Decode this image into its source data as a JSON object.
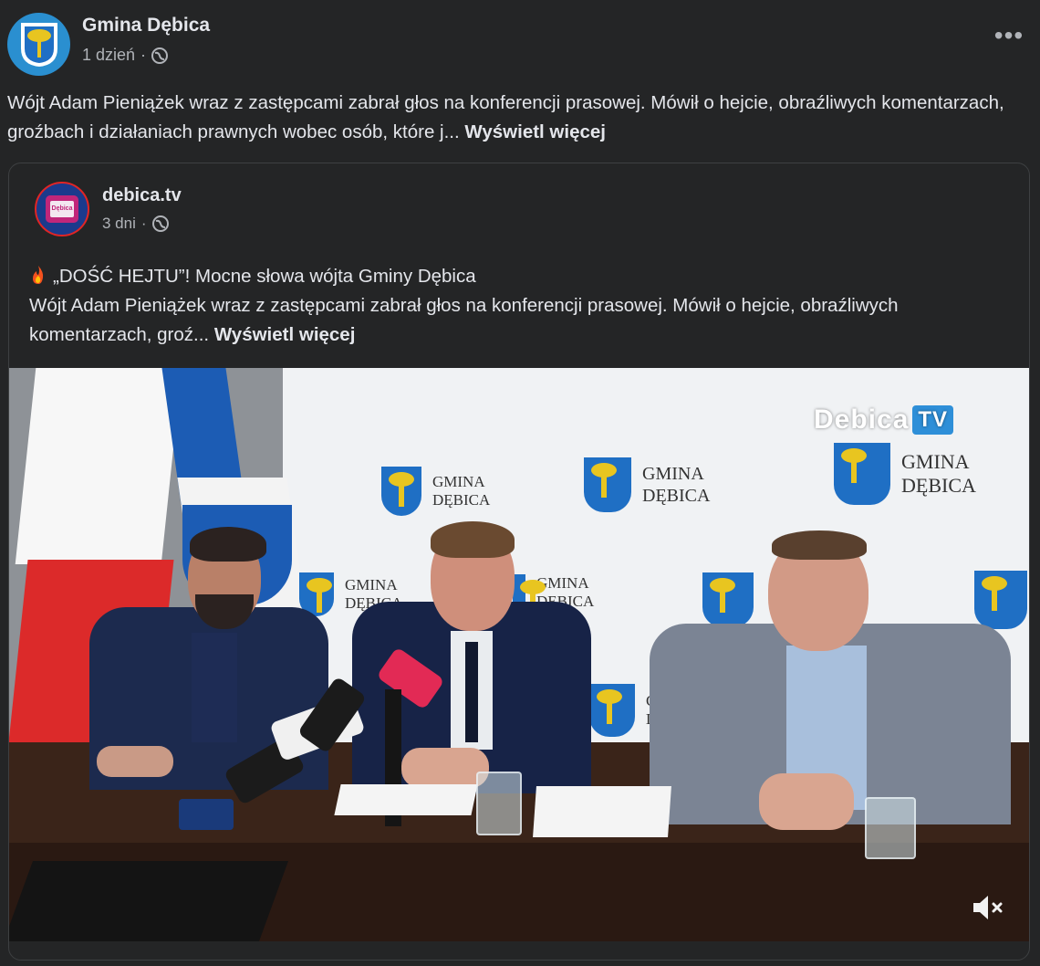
{
  "post": {
    "author": "Gmina Dębica",
    "time": "1 dzień",
    "separator": "·",
    "text": "Wójt Adam Pieniążek wraz z zastępcami zabrał głos na konferencji prasowej. Mówił o hejcie, obraźliwych komentarzach, groźbach i działaniach prawnych wobec osób, które j...",
    "see_more": "Wyświetl więcej",
    "more_icon": "more-horizontal-icon",
    "audience_icon": "globe-icon"
  },
  "shared": {
    "author": "debica.tv",
    "time": "3 dni",
    "separator": "·",
    "title": "„DOŚĆ HEJTU”! Mocne słowa wójta Gminy Dębica",
    "title_icon": "fire-emoji-icon",
    "text": "Wójt Adam Pieniążek wraz z zastępcami zabrał głos na konferencji prasowej. Mówił o hejcie, obraźliwych komentarzach, groź...",
    "see_more": "Wyświetl więcej",
    "audience_icon": "globe-icon"
  },
  "video": {
    "watermark_text": "Debica",
    "watermark_badge": "TV",
    "backdrop_line1": "GMINA",
    "backdrop_line2": "DĘBICA",
    "mute_icon": "speaker-muted-icon"
  },
  "colors": {
    "background": "#242526",
    "text_primary": "#e4e6eb",
    "text_secondary": "#b0b3b8",
    "border": "#3e4042"
  }
}
